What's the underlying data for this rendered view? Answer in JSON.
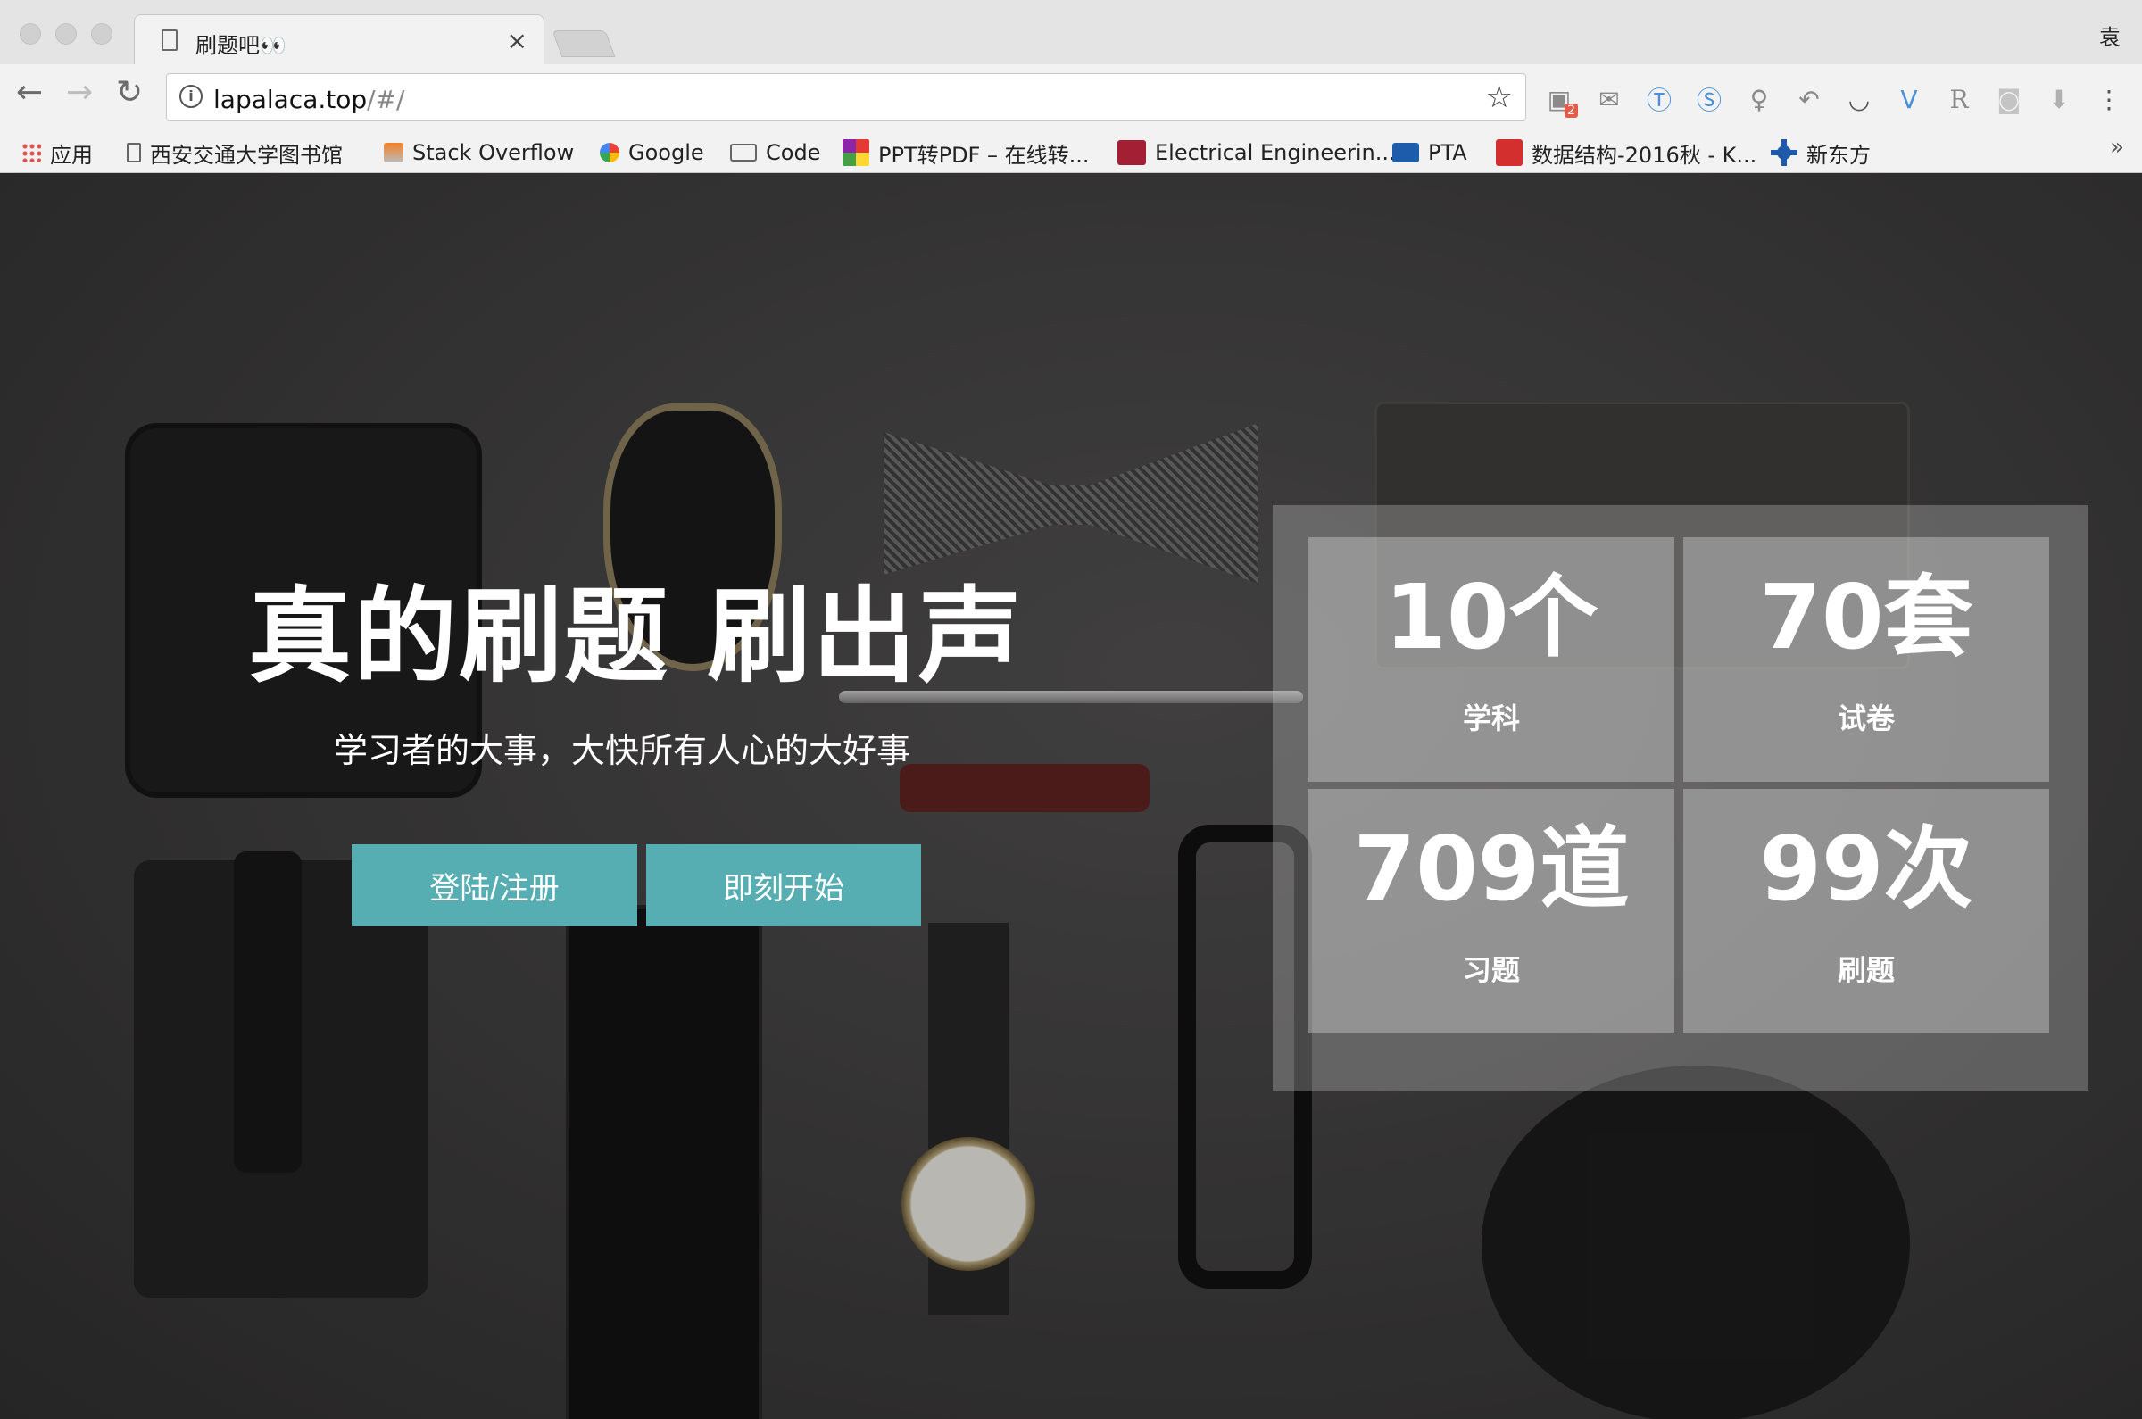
{
  "browser": {
    "tab": {
      "title": "刷题吧👀",
      "close": "×"
    },
    "profile_name": "袁",
    "nav": {
      "back": "←",
      "forward": "→",
      "reload": "↻"
    },
    "omnibox": {
      "info": "i",
      "host": "lapalaca.top",
      "path": "/#/",
      "star": "☆"
    },
    "extensions": [
      "chat-badge-icon",
      "mail-icon",
      "translate-icon",
      "s-icon",
      "bulb-icon",
      "reply-icon",
      "pocket-icon",
      "vee-icon",
      "r-icon",
      "camera-icon",
      "download-icon",
      "menu-icon"
    ],
    "menu_glyph": "⋮"
  },
  "bookmarks": [
    {
      "label": "应用",
      "icon": "apps-grid-icon"
    },
    {
      "label": "西安交通大学图书馆",
      "icon": "page-icon"
    },
    {
      "label": "Stack Overflow",
      "icon": "stackoverflow-icon"
    },
    {
      "label": "Google",
      "icon": "google-icon"
    },
    {
      "label": "Code",
      "icon": "folder-icon"
    },
    {
      "label": "PPT转PDF – 在线转...",
      "icon": "ppt-icon"
    },
    {
      "label": "Electrical Engineerin...",
      "icon": "mit-icon"
    },
    {
      "label": "PTA",
      "icon": "pta-icon"
    },
    {
      "label": "数据结构-2016秋 - K...",
      "icon": "c-icon"
    },
    {
      "label": "新东方",
      "icon": "xdf-icon"
    }
  ],
  "bookmarks_more": "»",
  "hero": {
    "headline": "真的刷题 刷出声",
    "subline": "学习者的大事，大快所有人心的大好事",
    "login_button": "登陆/注册",
    "start_button": "即刻开始"
  },
  "stats": [
    {
      "number": "10个",
      "label": "学科"
    },
    {
      "number": "70套",
      "label": "试卷"
    },
    {
      "number": "709道",
      "label": "习题"
    },
    {
      "number": "99次",
      "label": "刷题"
    }
  ],
  "colors": {
    "accent": "#56aeb3"
  }
}
